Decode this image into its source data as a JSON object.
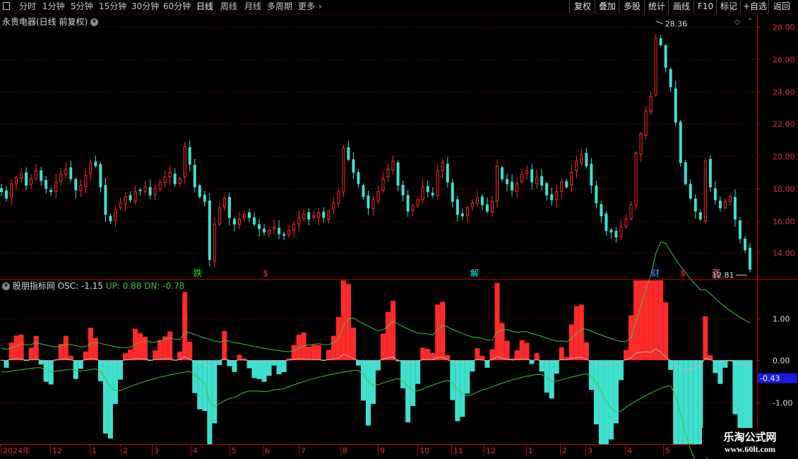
{
  "toolbar": {
    "tabs": [
      "分时",
      "1分钟",
      "5分钟",
      "15分钟",
      "30分钟",
      "60分钟",
      "日线",
      "周线",
      "月线",
      "多周期",
      "更多"
    ],
    "active_tab": "日线",
    "right_buttons": [
      "复权",
      "叠加",
      "多股",
      "统计",
      "画线",
      "F10",
      "标记",
      "+自选",
      "返回"
    ]
  },
  "stock": {
    "title": "永贵电器(日线 前复权)"
  },
  "price_axis": {
    "labels": [
      "28.00",
      "26.00",
      "24.00",
      "22.00",
      "20.00",
      "18.00",
      "16.00",
      "14.00"
    ],
    "min": 12.4,
    "max": 28.8
  },
  "price_annotations": {
    "high": "28.36",
    "low": "12.81"
  },
  "event_markers": [
    {
      "label": "跌",
      "color": "#00ff00"
    },
    {
      "label": "$",
      "color": "#ff3030"
    },
    {
      "label": "解",
      "color": "#00ffff"
    },
    {
      "label": "财",
      "color": "#40a0ff"
    },
    {
      "label": "$",
      "color": "#ff3030"
    },
    {
      "label": "涨",
      "color": "#ff8080"
    }
  ],
  "indicator": {
    "name": "股朋指标网",
    "osc_label": "OSC: -1.15",
    "up_label": "UP: 0.88",
    "dn_label": "DN: -0.78",
    "axis_labels": [
      "1.00",
      "0.00",
      "-1.00"
    ],
    "current_value": "-0.43",
    "osc_min": -2.0,
    "osc_max": 1.9
  },
  "time_axis": {
    "labels": [
      "2024年",
      "12",
      "1",
      "2",
      "3",
      "4",
      "5",
      "6",
      "7",
      "8",
      "9",
      "10",
      "11",
      "12",
      "1",
      "2",
      "3",
      "4",
      "5"
    ]
  },
  "watermark": {
    "title": "乐淘公式网",
    "url": "www.60lt.com"
  },
  "colors": {
    "up": "#ff2a2a",
    "down": "#40e0d0",
    "axis": "#c00000",
    "grid": "#6a0000",
    "osc_line": "#b8b8b8",
    "up_line": "#40c040",
    "dn_line": "#40c040",
    "label_box": "#1a1ae0"
  },
  "chart_data": [
    {
      "type": "candlestick",
      "title": "永贵电器(日线 前复权)",
      "ylim": [
        12.4,
        28.8
      ],
      "annotated_high": 28.36,
      "annotated_low": 12.81,
      "close_series": [
        17.8,
        17.4,
        18.3,
        18.7,
        18.9,
        18.2,
        18.6,
        19.1,
        18.5,
        18.0,
        17.8,
        18.4,
        18.9,
        19.2,
        18.6,
        17.9,
        18.2,
        18.8,
        19.6,
        19.4,
        18.1,
        16.4,
        16.0,
        16.7,
        17.1,
        17.5,
        17.3,
        17.8,
        17.9,
        18.1,
        17.6,
        18.0,
        18.4,
        18.7,
        19.0,
        18.3,
        18.6,
        20.6,
        19.5,
        18.1,
        17.5,
        17.2,
        13.6,
        15.8,
        16.8,
        17.4,
        16.2,
        15.8,
        16.1,
        16.4,
        16.2,
        15.8,
        15.5,
        15.3,
        15.4,
        15.6,
        15.2,
        15.1,
        15.4,
        15.8,
        16.2,
        16.4,
        16.1,
        16.3,
        16.5,
        16.2,
        16.6,
        17.1,
        17.8,
        20.5,
        19.8,
        19.0,
        18.3,
        17.5,
        16.8,
        17.3,
        17.8,
        18.6,
        19.2,
        19.7,
        18.2,
        17.6,
        16.6,
        16.9,
        17.3,
        18.1,
        17.8,
        17.6,
        19.1,
        19.6,
        18.4,
        17.2,
        16.4,
        16.3,
        16.8,
        17.1,
        17.4,
        17.0,
        16.6,
        17.2,
        19.4,
        18.6,
        18.3,
        17.9,
        18.3,
        18.9,
        19.1,
        18.4,
        18.7,
        18.2,
        17.6,
        17.3,
        17.8,
        18.4,
        18.1,
        19.0,
        19.7,
        20.1,
        19.4,
        18.2,
        17.1,
        16.3,
        15.4,
        15.3,
        15.0,
        15.6,
        16.1,
        17.0,
        20.2,
        21.4,
        22.8,
        23.7,
        27.3,
        26.9,
        25.5,
        24.3,
        22.1,
        19.6,
        18.3,
        17.4,
        16.6,
        16.1,
        19.7,
        18.1,
        17.3,
        16.8,
        17.2,
        17.5,
        16.1,
        14.9,
        14.2,
        13.0
      ],
      "periods": [
        "2024年",
        "12",
        "1",
        "2",
        "3",
        "4",
        "5",
        "6",
        "7",
        "8",
        "9",
        "10",
        "11",
        "12",
        "1",
        "2",
        "3",
        "4",
        "5"
      ]
    },
    {
      "type": "bar",
      "title": "股朋指标网",
      "series_names": [
        "OSC",
        "UP",
        "DN"
      ],
      "ylim": [
        -2.0,
        1.9
      ],
      "latest": {
        "OSC": -1.15,
        "UP": 0.88,
        "DN": -0.78
      }
    }
  ]
}
